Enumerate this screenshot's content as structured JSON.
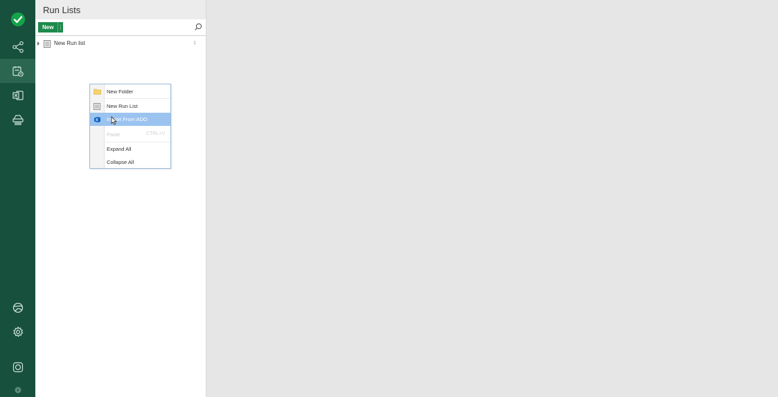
{
  "nav": {
    "items": [
      {
        "icon": "status-check-icon"
      },
      {
        "icon": "network-icon"
      },
      {
        "icon": "run-lists-icon"
      },
      {
        "icon": "excel-icon"
      },
      {
        "icon": "drive-icon"
      },
      {
        "icon": "globe-icon"
      },
      {
        "icon": "gear-icon"
      },
      {
        "icon": "help-icon"
      },
      {
        "icon": "expand-icon"
      }
    ],
    "active_index": 2,
    "status_color": "#16a34a"
  },
  "panel": {
    "title": "Run Lists",
    "new_button_label": "New",
    "new_button_more": "⋮",
    "search_placeholder": ""
  },
  "tree": {
    "items": [
      {
        "label": "New Run list",
        "count": "1"
      }
    ]
  },
  "context_menu": {
    "items": [
      {
        "icon": "folder-icon",
        "label": "New Folder",
        "shortcut": "",
        "state": "normal"
      },
      {
        "icon": "list-icon",
        "label": "New Run List",
        "shortcut": "",
        "state": "normal"
      },
      {
        "icon": "ado-icon",
        "label": "Import From ADO",
        "shortcut": "",
        "state": "hover"
      },
      {
        "icon": "",
        "label": "Paste",
        "shortcut": "CTRL+V",
        "state": "disabled"
      },
      {
        "icon": "",
        "label": "Expand All",
        "shortcut": "",
        "state": "normal"
      },
      {
        "icon": "",
        "label": "Collapse All",
        "shortcut": "",
        "state": "normal"
      }
    ]
  },
  "colors": {
    "rail_bg": "#17503d",
    "accent_green": "#1e8a4c",
    "menu_hover": "#9bc3ef"
  }
}
